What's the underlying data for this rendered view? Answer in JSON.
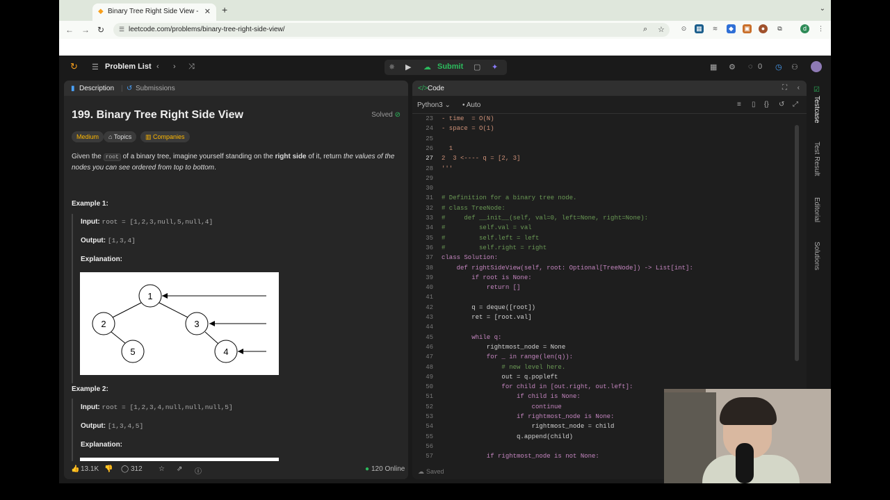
{
  "browser": {
    "tab_title": "Binary Tree Right Side View -",
    "url": "leetcode.com/problems/binary-tree-right-side-view/",
    "profile_initial": "d"
  },
  "header": {
    "problem_list": "Problem List",
    "submit": "Submit",
    "coins": "0"
  },
  "left": {
    "tab_description": "Description",
    "tab_submissions": "Submissions",
    "title": "199. Binary Tree Right Side View",
    "solved": "Solved",
    "difficulty": "Medium",
    "topics": "Topics",
    "companies": "Companies",
    "desc_1": "Given the",
    "desc_code": "root",
    "desc_2": "of a binary tree, imagine yourself standing on the",
    "desc_bold": "right side",
    "desc_3": "of it, return",
    "desc_italic": "the values of the nodes you can see ordered from top to bottom",
    "desc_end": ".",
    "ex1_title": "Example 1:",
    "ex1_input_label": "Input:",
    "ex1_input": "root = [1,2,3,null,5,null,4]",
    "ex1_output_label": "Output:",
    "ex1_output": "[1,3,4]",
    "explanation_label": "Explanation:",
    "ex2_title": "Example 2:",
    "ex2_input": "root = [1,2,3,4,null,null,null,5]",
    "ex2_output": "[1,3,4,5]",
    "likes": "13.1K",
    "comments": "312",
    "online": "120 Online",
    "tree_nodes": [
      "1",
      "2",
      "3",
      "5",
      "4"
    ]
  },
  "right": {
    "code_label": "Code",
    "language": "Python3",
    "auto": "Auto",
    "saved": "Saved",
    "lines": [
      {
        "n": "23",
        "t": "- time  = O(N)"
      },
      {
        "n": "24",
        "t": "- space = O(1)"
      },
      {
        "n": "25",
        "t": ""
      },
      {
        "n": "26",
        "t": "  1"
      },
      {
        "n": "27",
        "t": "2  3 <---- q = [2, 3]"
      },
      {
        "n": "28",
        "t": "'''"
      },
      {
        "n": "29",
        "t": ""
      },
      {
        "n": "30",
        "t": ""
      },
      {
        "n": "31",
        "t": "# Definition for a binary tree node."
      },
      {
        "n": "32",
        "t": "# class TreeNode:"
      },
      {
        "n": "33",
        "t": "#     def __init__(self, val=0, left=None, right=None):"
      },
      {
        "n": "34",
        "t": "#         self.val = val"
      },
      {
        "n": "35",
        "t": "#         self.left = left"
      },
      {
        "n": "36",
        "t": "#         self.right = right"
      },
      {
        "n": "37",
        "t": "class Solution:"
      },
      {
        "n": "38",
        "t": "    def rightSideView(self, root: Optional[TreeNode]) -> List[int]:"
      },
      {
        "n": "39",
        "t": "        if root is None:"
      },
      {
        "n": "40",
        "t": "            return []"
      },
      {
        "n": "41",
        "t": ""
      },
      {
        "n": "42",
        "t": "        q = deque([root])"
      },
      {
        "n": "43",
        "t": "        ret = [root.val]"
      },
      {
        "n": "44",
        "t": ""
      },
      {
        "n": "45",
        "t": "        while q:"
      },
      {
        "n": "46",
        "t": "            rightmost_node = None"
      },
      {
        "n": "47",
        "t": "            for _ in range(len(q)):"
      },
      {
        "n": "48",
        "t": "                # new level here."
      },
      {
        "n": "49",
        "t": "                out = q.popleft"
      },
      {
        "n": "50",
        "t": "                for child in [out.right, out.left]:"
      },
      {
        "n": "51",
        "t": "                    if child is None:"
      },
      {
        "n": "52",
        "t": "                        continue"
      },
      {
        "n": "53",
        "t": "                    if rightmost_node is None:"
      },
      {
        "n": "54",
        "t": "                        rightmost_node = child"
      },
      {
        "n": "55",
        "t": "                    q.append(child)"
      },
      {
        "n": "56",
        "t": ""
      },
      {
        "n": "57",
        "t": "            if rightmost_node is not None:"
      }
    ]
  },
  "sidebar": {
    "testcase": "Testcase",
    "test_result": "Test Result",
    "editorial": "Editorial",
    "solutions": "Solutions"
  }
}
